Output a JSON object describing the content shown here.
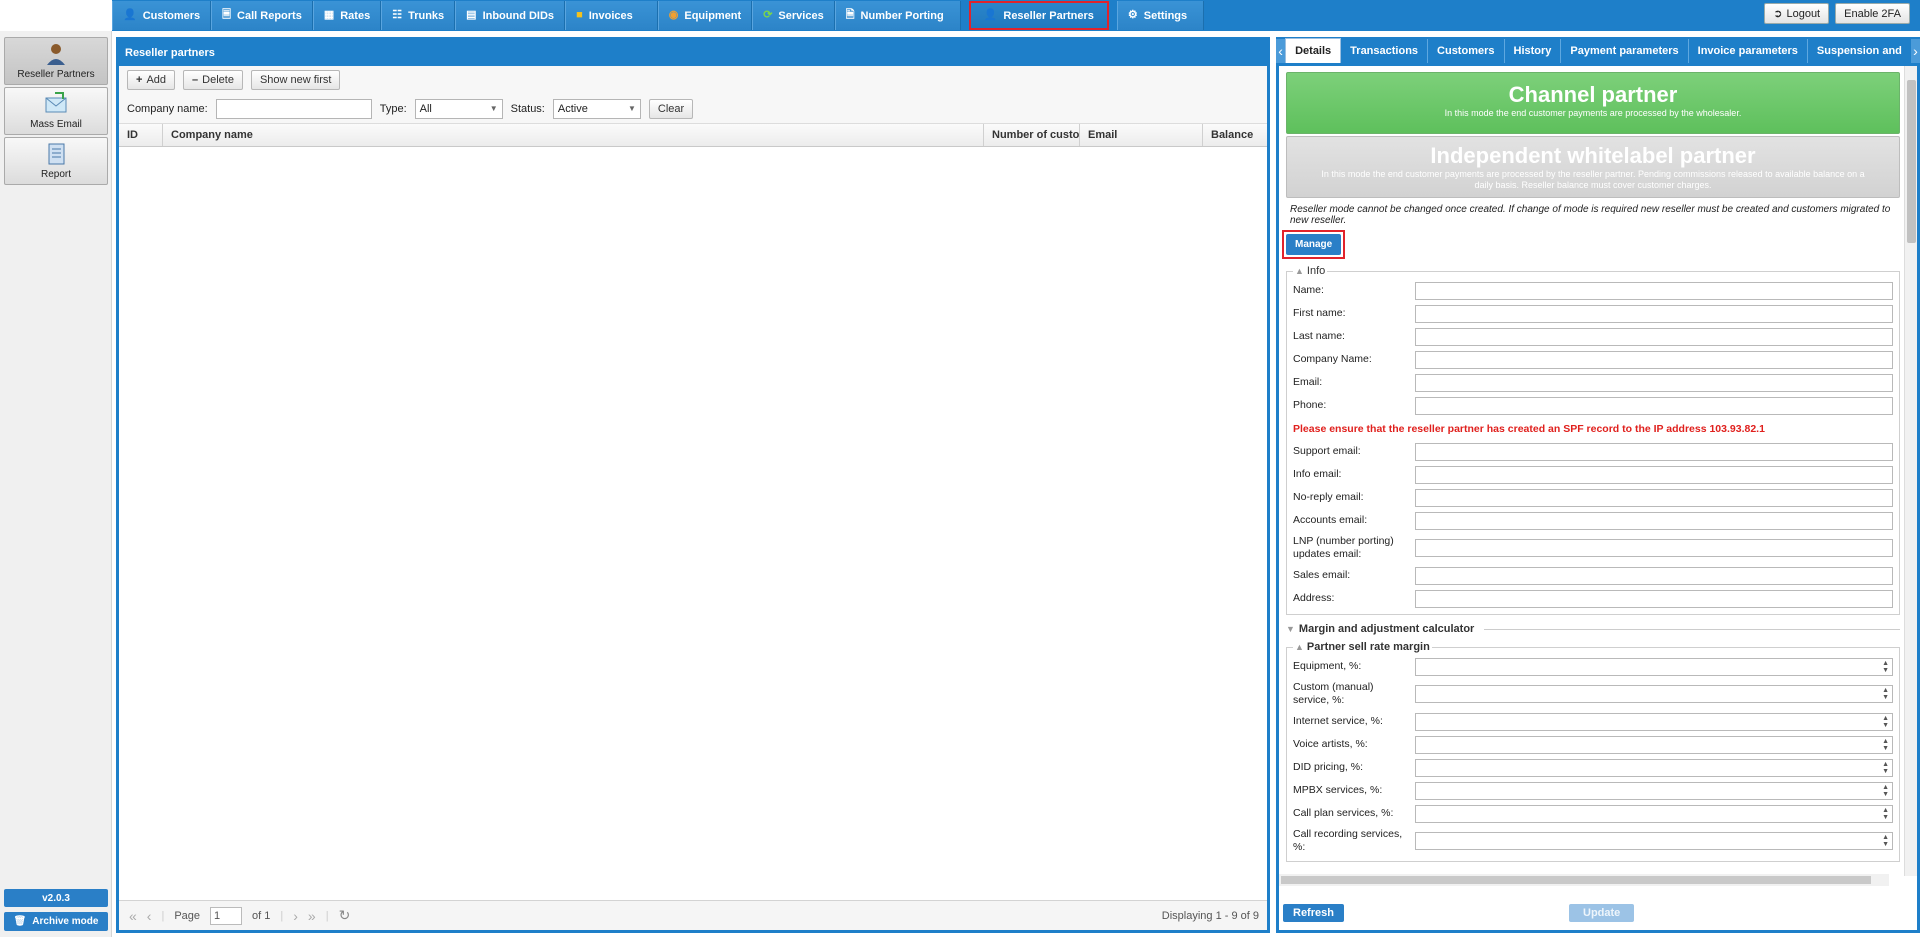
{
  "nav": {
    "tabs": [
      {
        "label": "Customers",
        "icon": "person-icon"
      },
      {
        "label": "Call Reports",
        "icon": "report-icon"
      },
      {
        "label": "Rates",
        "icon": "rates-icon"
      },
      {
        "label": "Trunks",
        "icon": "trunks-icon"
      },
      {
        "label": "Inbound DIDs",
        "icon": "did-icon"
      },
      {
        "label": "Invoices",
        "icon": "invoice-icon"
      },
      {
        "label": "Equipment",
        "icon": "equipment-icon"
      },
      {
        "label": "Services",
        "icon": "services-icon"
      },
      {
        "label": "Number Porting",
        "icon": "porting-icon"
      },
      {
        "label": "Reseller Partners",
        "icon": "reseller-icon"
      },
      {
        "label": "Settings",
        "icon": "settings-icon"
      }
    ],
    "active": "Reseller Partners",
    "logout_label": "Logout",
    "enable2fa_label": "Enable 2FA"
  },
  "rail": {
    "items": [
      {
        "label": "Reseller Partners",
        "icon": "reseller-partners-icon"
      },
      {
        "label": "Mass Email",
        "icon": "mass-email-icon"
      },
      {
        "label": "Report",
        "icon": "report-icon"
      }
    ],
    "version": "v2.0.3",
    "archive_label": "Archive mode"
  },
  "list": {
    "title": "Reseller partners",
    "add_label": "Add",
    "delete_label": "Delete",
    "show_new_label": "Show new first",
    "filters": {
      "company_label": "Company name:",
      "company_value": "",
      "type_label": "Type:",
      "type_value": "All",
      "status_label": "Status:",
      "status_value": "Active",
      "clear_label": "Clear"
    },
    "columns": [
      "ID",
      "Company name",
      "Number of custon",
      "Email",
      "Balance"
    ],
    "pager": {
      "page_label": "Page",
      "page_value": "1",
      "of_label": "of 1",
      "display": "Displaying 1 - 9 of 9"
    }
  },
  "detail": {
    "tabs": [
      "Details",
      "Transactions",
      "Customers",
      "History",
      "Payment parameters",
      "Invoice parameters",
      "Suspension and"
    ],
    "active_tab": "Details",
    "channel": {
      "title": "Channel partner",
      "desc": "In this mode the end customer payments are processed by the wholesaler."
    },
    "independent": {
      "title": "Independent whitelabel partner",
      "desc": "In this mode the end customer payments are processed by the reseller partner. Pending commissions released to available balance on a daily basis. Reseller balance must cover customer charges."
    },
    "notice": "Reseller mode cannot be changed once created. If change of mode is required new reseller must be created and customers migrated to new reseller.",
    "manage_label": "Manage",
    "info": {
      "legend": "Info",
      "fields_top": [
        {
          "label": "Name:",
          "value": ""
        },
        {
          "label": "First name:",
          "value": ""
        },
        {
          "label": "Last name:",
          "value": ""
        },
        {
          "label": "Company Name:",
          "value": ""
        },
        {
          "label": "Email:",
          "value": ""
        },
        {
          "label": "Phone:",
          "value": ""
        }
      ],
      "spf_warning": "Please ensure that the reseller partner has created an SPF record to the IP address 103.93.82.1",
      "fields_bottom": [
        {
          "label": "Support email:",
          "value": ""
        },
        {
          "label": "Info email:",
          "value": ""
        },
        {
          "label": "No-reply email:",
          "value": ""
        },
        {
          "label": "Accounts email:",
          "value": ""
        },
        {
          "label": "LNP (number porting) updates email:",
          "value": ""
        },
        {
          "label": "Sales email:",
          "value": ""
        },
        {
          "label": "Address:",
          "value": ""
        }
      ]
    },
    "margin_section": "Margin and adjustment calculator",
    "sell_margin": {
      "legend": "Partner sell rate margin",
      "fields": [
        {
          "label": "Equipment, %:",
          "value": ""
        },
        {
          "label": "Custom (manual) service, %:",
          "value": ""
        },
        {
          "label": "Internet service, %:",
          "value": ""
        },
        {
          "label": "Voice artists, %:",
          "value": ""
        },
        {
          "label": "DID pricing, %:",
          "value": ""
        },
        {
          "label": "MPBX services, %:",
          "value": ""
        },
        {
          "label": "Call plan services, %:",
          "value": ""
        },
        {
          "label": "Call recording services, %:",
          "value": ""
        }
      ]
    },
    "refresh_label": "Refresh",
    "update_label": "Update"
  }
}
